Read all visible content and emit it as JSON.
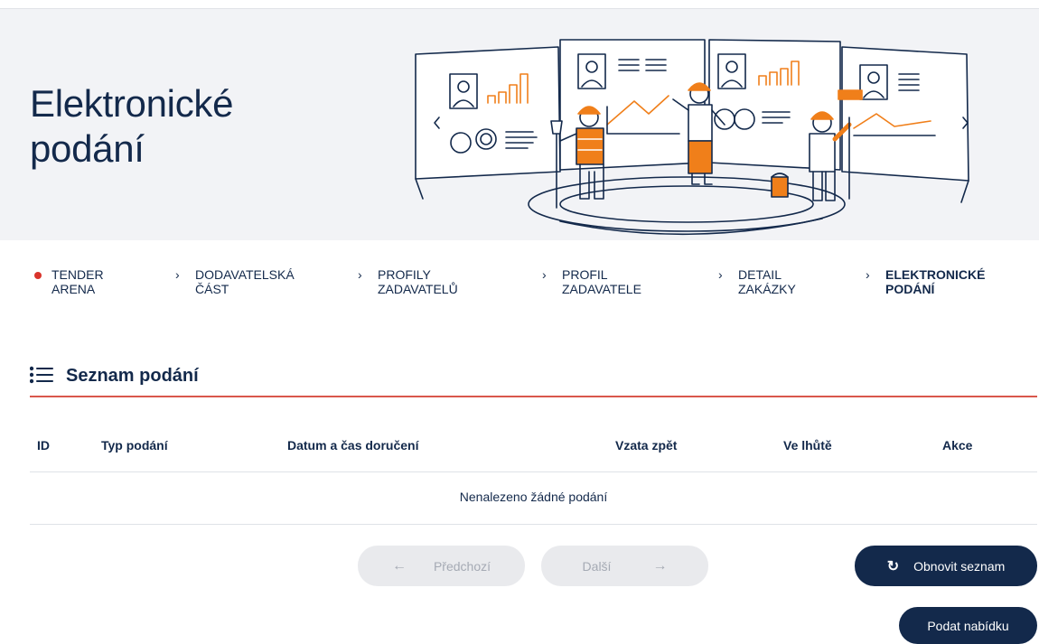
{
  "banner": {
    "title_line1": "Elektronické",
    "title_line2": "podání"
  },
  "breadcrumbs": [
    {
      "line1": "TENDER",
      "line2": "ARENA",
      "marker": "dot"
    },
    {
      "line1": "DODAVATELSKÁ",
      "line2": "ČÁST",
      "marker": "›"
    },
    {
      "line1": "PROFILY",
      "line2": "ZADAVATELŮ",
      "marker": "›"
    },
    {
      "line1": "PROFIL",
      "line2": "ZADAVATELE",
      "marker": "›"
    },
    {
      "line1": "DETAIL",
      "line2": "ZAKÁZKY",
      "marker": "›"
    },
    {
      "line1": "ELEKTRONICKÉ",
      "line2": "PODÁNÍ",
      "marker": "›",
      "active": true
    }
  ],
  "section": {
    "title": "Seznam podání",
    "icon": "list-icon"
  },
  "table": {
    "columns": [
      "ID",
      "Typ podání",
      "Datum a čas doručení",
      "Vzata zpět",
      "Ve lhůtě",
      "Akce"
    ],
    "empty_message": "Nenalezeno žádné podání"
  },
  "pagination": {
    "prev_label": "Předchozí",
    "prev_icon": "arrow-left-icon",
    "next_label": "Další",
    "next_icon": "arrow-right-icon"
  },
  "actions": {
    "refresh_label": "Obnovit seznam",
    "refresh_icon": "refresh-icon",
    "submit_label": "Podat nabídku"
  },
  "colors": {
    "navy": "#13294b",
    "accent_red": "#d9342b",
    "divider_red": "#d9574c",
    "orange": "#f07f1a",
    "banner_bg": "#f2f3f6"
  }
}
